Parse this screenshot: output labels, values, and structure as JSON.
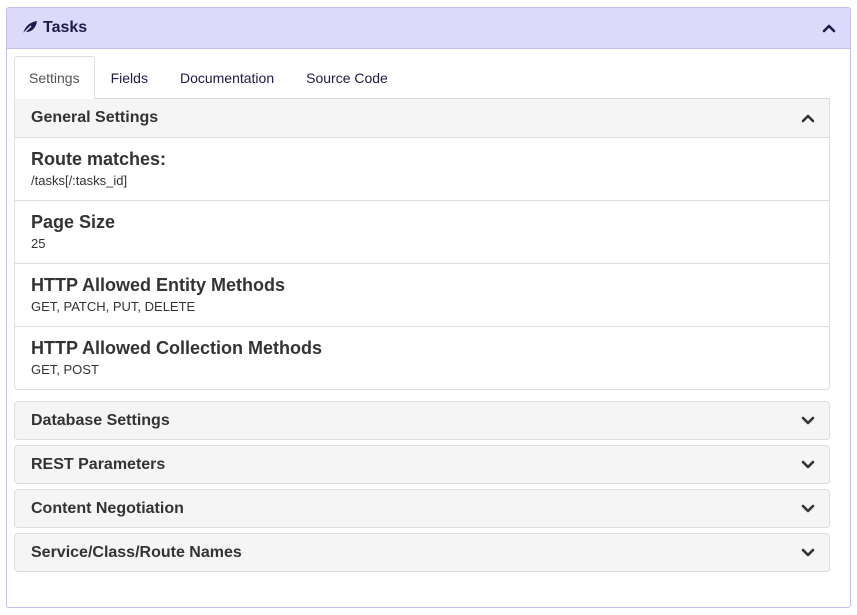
{
  "panel": {
    "title": "Tasks",
    "icon": "leaf-icon",
    "toggle_icon": "chevron-up-icon",
    "header_color": "#dcd9fb"
  },
  "tabs": [
    {
      "label": "Settings",
      "active": true
    },
    {
      "label": "Fields",
      "active": false
    },
    {
      "label": "Documentation",
      "active": false
    },
    {
      "label": "Source Code",
      "active": false
    }
  ],
  "general_settings": {
    "title": "General Settings",
    "toggle_icon": "chevron-up-icon",
    "rows": [
      {
        "name": "Route matches:",
        "value": "/tasks[/:tasks_id]"
      },
      {
        "name": "Page Size",
        "value": "25"
      },
      {
        "name": "HTTP Allowed Entity Methods",
        "value": "GET, PATCH, PUT, DELETE"
      },
      {
        "name": "HTTP Allowed Collection Methods",
        "value": "GET, POST"
      }
    ]
  },
  "collapsed_sections": [
    {
      "title": "Database Settings",
      "toggle_icon": "chevron-down-icon"
    },
    {
      "title": "REST Parameters",
      "toggle_icon": "chevron-down-icon"
    },
    {
      "title": "Content Negotiation",
      "toggle_icon": "chevron-down-icon"
    },
    {
      "title": "Service/Class/Route Names",
      "toggle_icon": "chevron-down-icon"
    }
  ]
}
